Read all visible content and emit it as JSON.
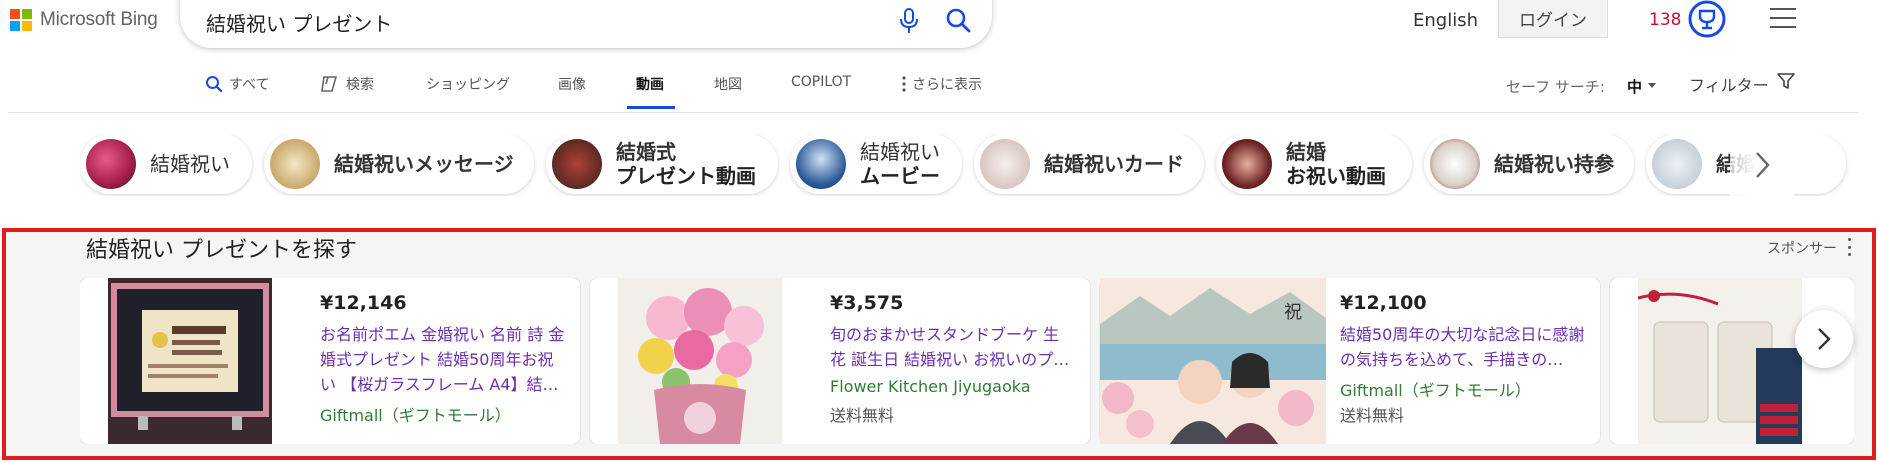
{
  "header": {
    "logo_text": "Microsoft Bing",
    "search_query": "結婚祝い プレゼント",
    "language_link": "English",
    "login_label": "ログイン",
    "rewards_count": "138",
    "brand_colors": {
      "red": "#f25022",
      "green": "#7fba00",
      "blue": "#00a4ef",
      "yellow": "#ffb900"
    },
    "accent_color": "#174ae4"
  },
  "tabs": [
    {
      "label": "すべて",
      "icon": "search-icon"
    },
    {
      "label": "検索",
      "icon": "copilot-icon"
    },
    {
      "label": "ショッピング"
    },
    {
      "label": "画像"
    },
    {
      "label": "動画",
      "active": true
    },
    {
      "label": "地図"
    },
    {
      "label": "COPILOT"
    },
    {
      "label": "さらに表示",
      "icon": "more-vertical-icon"
    }
  ],
  "safe_search": {
    "label": "セーフ サーチ:",
    "value": "中"
  },
  "filter": {
    "label": "フィルター"
  },
  "chips": [
    {
      "line1": "結婚祝い",
      "line2": ""
    },
    {
      "line1": "結婚祝いメッセージ",
      "line2": ""
    },
    {
      "line1": "結婚式",
      "line2": "プレゼント動画"
    },
    {
      "line1": "結婚祝い",
      "line2": "ムービー"
    },
    {
      "line1": "結婚祝いカード",
      "line2": ""
    },
    {
      "line1": "結婚",
      "line2": "お祝い動画"
    },
    {
      "line1": "結婚祝い持参",
      "line2": ""
    },
    {
      "line1": "結婚",
      "line2": ""
    }
  ],
  "shopping": {
    "title": "結婚祝い プレゼントを探す",
    "sponsor_label": "スポンサー",
    "cards": [
      {
        "price": "¥12,146",
        "title": "お名前ポエム 金婚祝い 名前 詩 金婚式プレゼント 結婚50周年お祝い 【桜ガラスフレーム A4】結…",
        "seller": "Giftmall（ギフトモール）",
        "shipping": ""
      },
      {
        "price": "¥3,575",
        "title": "旬のおまかせスタンドブーケ 生花 誕生日 結婚祝い お祝いのプ…",
        "seller": "Flower Kitchen Jiyugaoka",
        "shipping": "送料無料"
      },
      {
        "price": "¥12,100",
        "title": "結婚50周年の大切な記念日に感謝の気持ちを込めて、手描きの…",
        "seller": "Giftmall（ギフトモール）",
        "shipping": "送料無料"
      },
      {
        "price": "",
        "title": "",
        "seller": "",
        "shipping": ""
      }
    ]
  }
}
